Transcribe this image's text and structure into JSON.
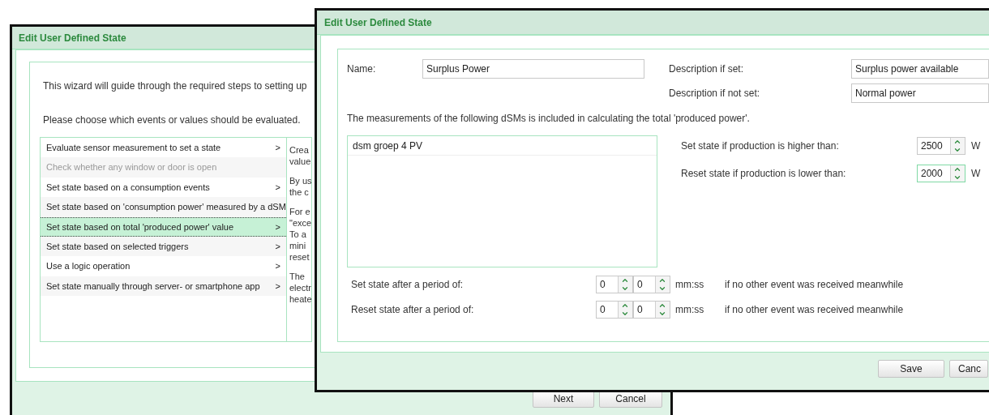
{
  "back_window": {
    "title": "Edit User Defined State",
    "intro": "This wizard will guide through the required steps to setting up",
    "prompt": "Please choose which events or values should be evaluated.",
    "options": [
      {
        "label": "Evaluate sensor measurement to set a state",
        "arrow": ">",
        "selected": false,
        "disabled": false
      },
      {
        "label": "Check whether any window or door is open",
        "selected": false,
        "disabled": true
      },
      {
        "label": "Set state based on a consumption events",
        "arrow": ">",
        "selected": false,
        "disabled": false
      },
      {
        "label": "Set state based on 'consumption power' measured by a dSM",
        "selected": false,
        "disabled": false
      },
      {
        "label": "Set state based on total 'produced power' value",
        "arrow": ">",
        "selected": true,
        "disabled": false
      },
      {
        "label": "Set state based on selected triggers",
        "arrow": ">",
        "selected": false,
        "disabled": false
      },
      {
        "label": "Use a logic operation",
        "arrow": ">",
        "selected": false,
        "disabled": false
      },
      {
        "label": "Set state manually through server- or smartphone app",
        "arrow": ">",
        "selected": false,
        "disabled": false
      }
    ],
    "description": [
      [
        "Crea",
        "value"
      ],
      [
        "By us",
        "the c"
      ],
      [
        "For e",
        "\"exce",
        "To a",
        "mini",
        "reset"
      ],
      [
        "The",
        "electr",
        "heate"
      ]
    ],
    "buttons": [
      "Next",
      "Cancel"
    ]
  },
  "front_window": {
    "title": "Edit User Defined State",
    "name": {
      "label": "Name:",
      "value": "Surplus Power"
    },
    "descriptions": [
      {
        "label": "Description if set:",
        "value": "Surplus power available"
      },
      {
        "label": "Description if not set:",
        "value": "Normal power"
      }
    ],
    "note": "The measurements of the following dSMs is included in calculating the total 'produced power'.",
    "dsm_list": [
      "dsm groep 4 PV"
    ],
    "thresholds": [
      {
        "label": "Set state if production is higher than:",
        "value": "2500",
        "unit": "W",
        "focused": false
      },
      {
        "label": "Reset state if production is lower than:",
        "value": "2000",
        "unit": "W",
        "focused": true
      }
    ],
    "periods": [
      {
        "label": "Set state after a period of:",
        "minutes": "0",
        "seconds": "0",
        "unit": "mm:ss",
        "note": "if no other event was received meanwhile"
      },
      {
        "label": "Reset state after a period of:",
        "minutes": "0",
        "seconds": "0",
        "unit": "mm:ss",
        "note": "if no other event was received meanwhile"
      }
    ],
    "buttons": [
      "Save",
      "Canc"
    ]
  }
}
